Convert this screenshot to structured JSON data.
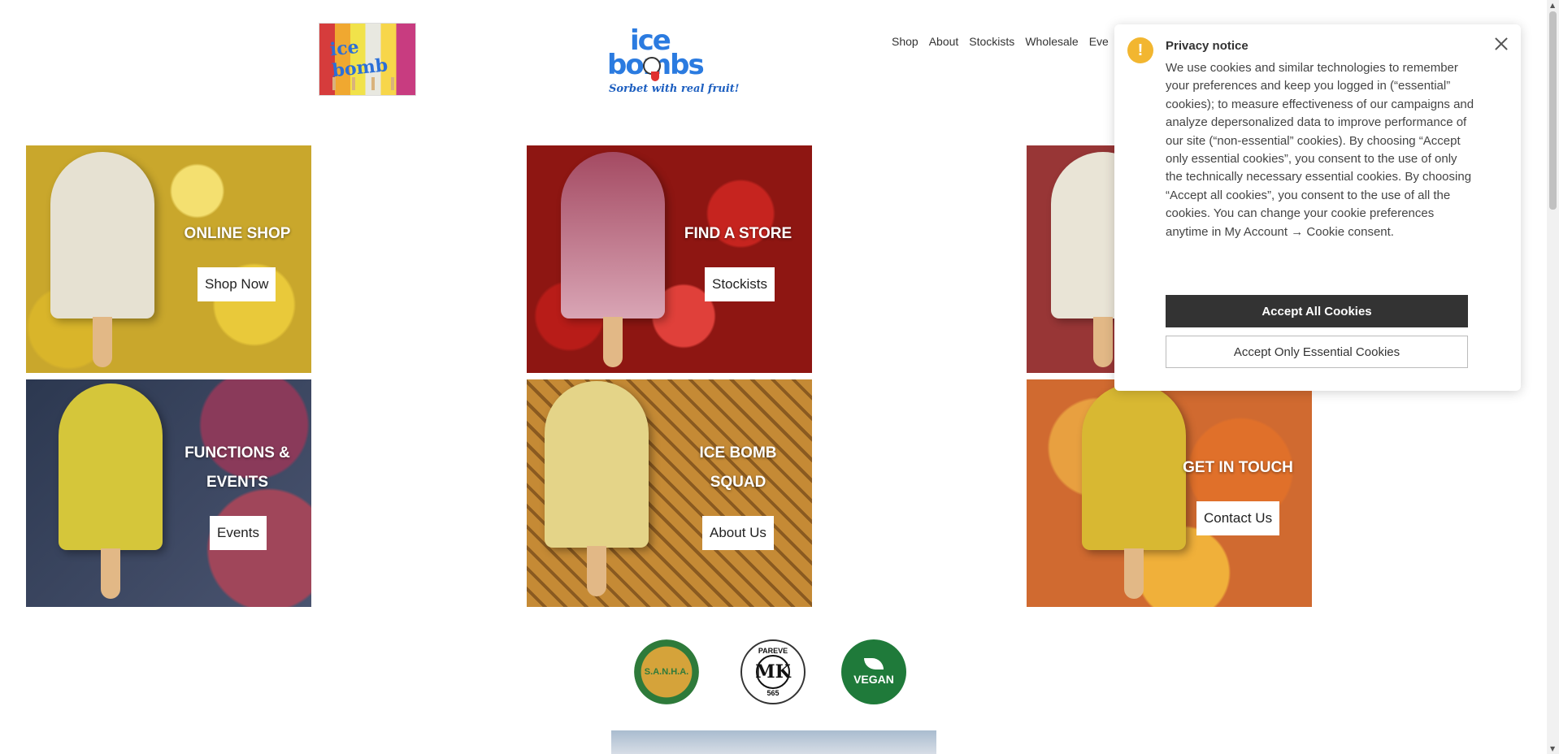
{
  "header": {
    "thumbnail_text": "ice bomb",
    "logo_line1": "ice",
    "logo_line2": "bombs",
    "logo_tagline": "Sorbet with real fruit!"
  },
  "nav": {
    "items": [
      "Shop",
      "About",
      "Stockists",
      "Wholesale",
      "Eve"
    ]
  },
  "tiles": [
    {
      "title": "ONLINE SHOP",
      "button": "Shop Now"
    },
    {
      "title": "FIND A STORE",
      "button": "Stockists"
    },
    {
      "title": "",
      "button": ""
    },
    {
      "title": "FUNCTIONS &",
      "title2": "EVENTS",
      "button": "Events"
    },
    {
      "title": "ICE BOMB",
      "title2": "SQUAD",
      "button": "About Us"
    },
    {
      "title": "GET IN TOUCH",
      "button": "Contact Us"
    }
  ],
  "badges": {
    "halaal": "S.A.N.H.A.",
    "pareve_top": "PAREVE",
    "pareve_mark": "MK",
    "pareve_num": "565",
    "vegan": "VEGAN"
  },
  "cookie": {
    "title": "Privacy notice",
    "icon": "!",
    "body": "We use cookies and similar technologies to remember your preferences and keep you logged in (“essential” cookies); to measure effectiveness of our campaigns and analyze depersonalized data to improve performance of our site (“non-essential” cookies). By choosing “Accept only essential cookies”, you consent to the use of only the technically necessary essential cookies. By choosing “Accept all cookies”, you consent to the use of all the cookies. You can change your cookie preferences anytime in My Account → Cookie consent.",
    "accept_all": "Accept All Cookies",
    "accept_essential": "Accept Only Essential Cookies"
  },
  "colors": {
    "brand_blue": "#2b7be0",
    "dark_button": "#333333",
    "warning": "#f2b630",
    "vegan_green": "#1f7a3a"
  }
}
